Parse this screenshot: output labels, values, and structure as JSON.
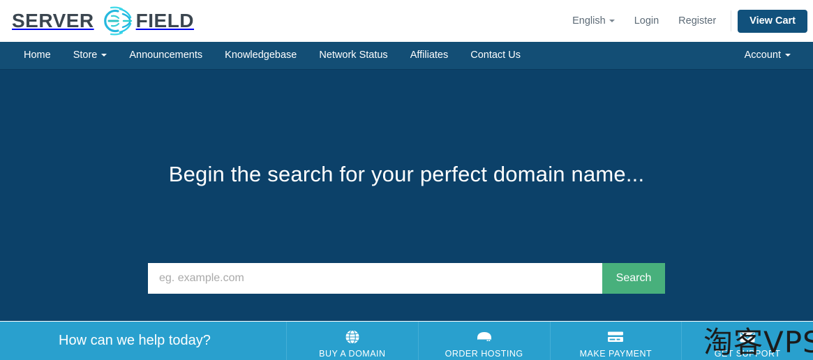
{
  "brand": {
    "name_left": "SERVER",
    "name_right": "FIELD",
    "logo_icon": "globe-arcs-icon",
    "mark_color": "#1fb6e0",
    "text_color": "#3b4650"
  },
  "topbar": {
    "language": "English",
    "login": "Login",
    "register": "Register",
    "cart_label": "View Cart",
    "cart_color": "#11517c"
  },
  "nav": {
    "bg_color": "#134e75",
    "items": [
      {
        "label": "Home",
        "has_caret": false
      },
      {
        "label": "Store",
        "has_caret": true
      },
      {
        "label": "Announcements",
        "has_caret": false
      },
      {
        "label": "Knowledgebase",
        "has_caret": false
      },
      {
        "label": "Network Status",
        "has_caret": false
      },
      {
        "label": "Affiliates",
        "has_caret": false
      },
      {
        "label": "Contact Us",
        "has_caret": false
      }
    ],
    "account": {
      "label": "Account",
      "has_caret": true
    }
  },
  "hero": {
    "bg_color": "#0c4169",
    "title": "Begin the search for your perfect domain name...",
    "search_placeholder": "eg. example.com",
    "search_value": "",
    "search_button": "Search",
    "search_button_color": "#48b07c"
  },
  "helpbar": {
    "bg_color": "#29a0ce",
    "title": "How can we help today?",
    "items": [
      {
        "label": "BUY A DOMAIN",
        "icon": "globe-icon"
      },
      {
        "label": "ORDER HOSTING",
        "icon": "server-icon"
      },
      {
        "label": "MAKE PAYMENT",
        "icon": "credit-card-icon"
      },
      {
        "label": "GET SUPPORT",
        "icon": "envelope-icon"
      }
    ]
  },
  "watermark": {
    "text": "淘客VPS"
  }
}
